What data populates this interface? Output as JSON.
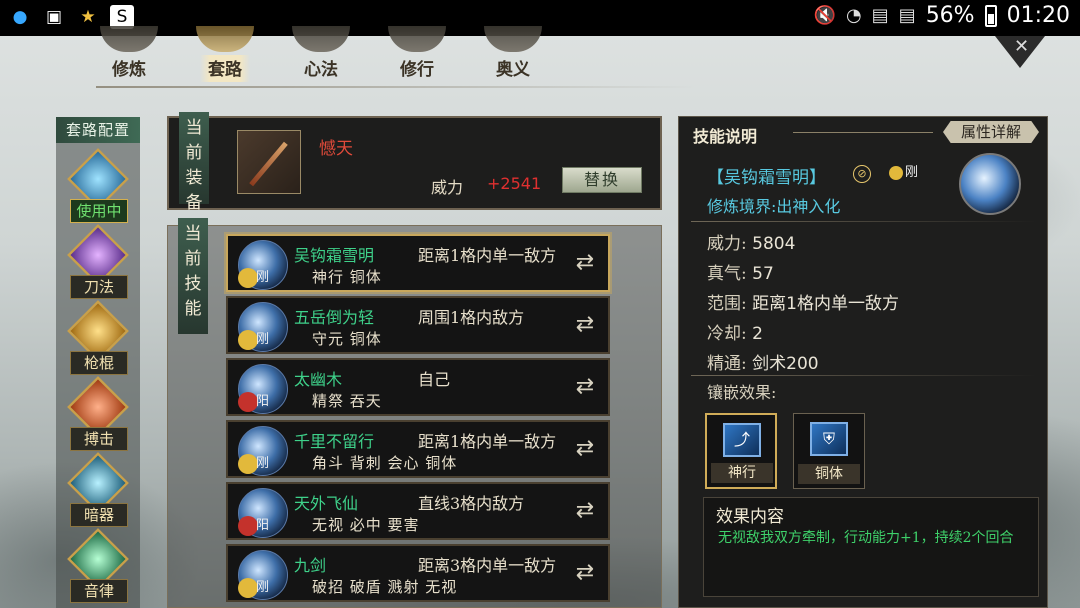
{
  "status_bar": {
    "battery_percent": "56%",
    "time": "01:20"
  },
  "nav": {
    "tabs": [
      {
        "label": "修炼",
        "active": false
      },
      {
        "label": "套路",
        "active": true
      },
      {
        "label": "心法",
        "active": false
      },
      {
        "label": "修行",
        "active": false
      },
      {
        "label": "奥义",
        "active": false
      }
    ]
  },
  "sidebar": {
    "title": "套路配置",
    "categories": [
      {
        "label": "使用中",
        "active": true
      },
      {
        "label": "刀法",
        "active": false
      },
      {
        "label": "枪棍",
        "active": false
      },
      {
        "label": "搏击",
        "active": false
      },
      {
        "label": "暗器",
        "active": false
      },
      {
        "label": "音律",
        "active": false
      }
    ]
  },
  "equipment": {
    "section_label": "当前装备",
    "weapon_name": "憾天",
    "power_label": "威力",
    "power_value": "+2541",
    "replace_button": "替换"
  },
  "skills": {
    "section_label": "当前技能",
    "items": [
      {
        "name": "吴钩霜雪明",
        "range": "距离1格内单一敌方",
        "tags": "神行 铜体",
        "element": "刚",
        "badge": "gold",
        "selected": true
      },
      {
        "name": "五岳倒为轻",
        "range": "周围1格内敌方",
        "tags": "守元 铜体",
        "element": "刚",
        "badge": "gold",
        "selected": false
      },
      {
        "name": "太幽木",
        "range": "自己",
        "tags": "精祭 吞天",
        "element": "阳",
        "badge": "red",
        "selected": false
      },
      {
        "name": "千里不留行",
        "range": "距离1格内单一敌方",
        "tags": "角斗 背刺 会心 铜体",
        "element": "刚",
        "badge": "gold",
        "selected": false
      },
      {
        "name": "天外飞仙",
        "range": "直线3格内敌方",
        "tags": "无视 必中 要害",
        "element": "阳",
        "badge": "red",
        "selected": false
      },
      {
        "name": "九剑",
        "range": "距离3格内单一敌方",
        "tags": "破招 破盾 溅射 无视",
        "element": "刚",
        "badge": "gold",
        "selected": false
      }
    ]
  },
  "detail": {
    "title": "技能说明",
    "attr_button": "属性详解",
    "skill_name": "【吴钩霜雪明】",
    "element": "刚",
    "realm": "修炼境界:出神入化",
    "stats": [
      {
        "label": "威力:",
        "value": "5804"
      },
      {
        "label": "真气:",
        "value": "57"
      },
      {
        "label": "范围:",
        "value": "距离1格内单一敌方"
      },
      {
        "label": "冷却:",
        "value": "2"
      },
      {
        "label": "精通:",
        "value": "剑术200"
      }
    ],
    "inlay_title": "镶嵌效果:",
    "inlays": [
      {
        "label": "神行",
        "selected": true
      },
      {
        "label": "铜体",
        "selected": false
      }
    ],
    "effect_title": "效果内容",
    "effect_text": "无视敌我双方牵制，行动能力+1，持续2个回合"
  },
  "colors": {
    "skill_name": "#3ed18a",
    "detail_cyan": "#58c9e0",
    "power_red": "#e03030",
    "effect_green": "#3ed16a",
    "accent_gold": "#c8a75c"
  }
}
